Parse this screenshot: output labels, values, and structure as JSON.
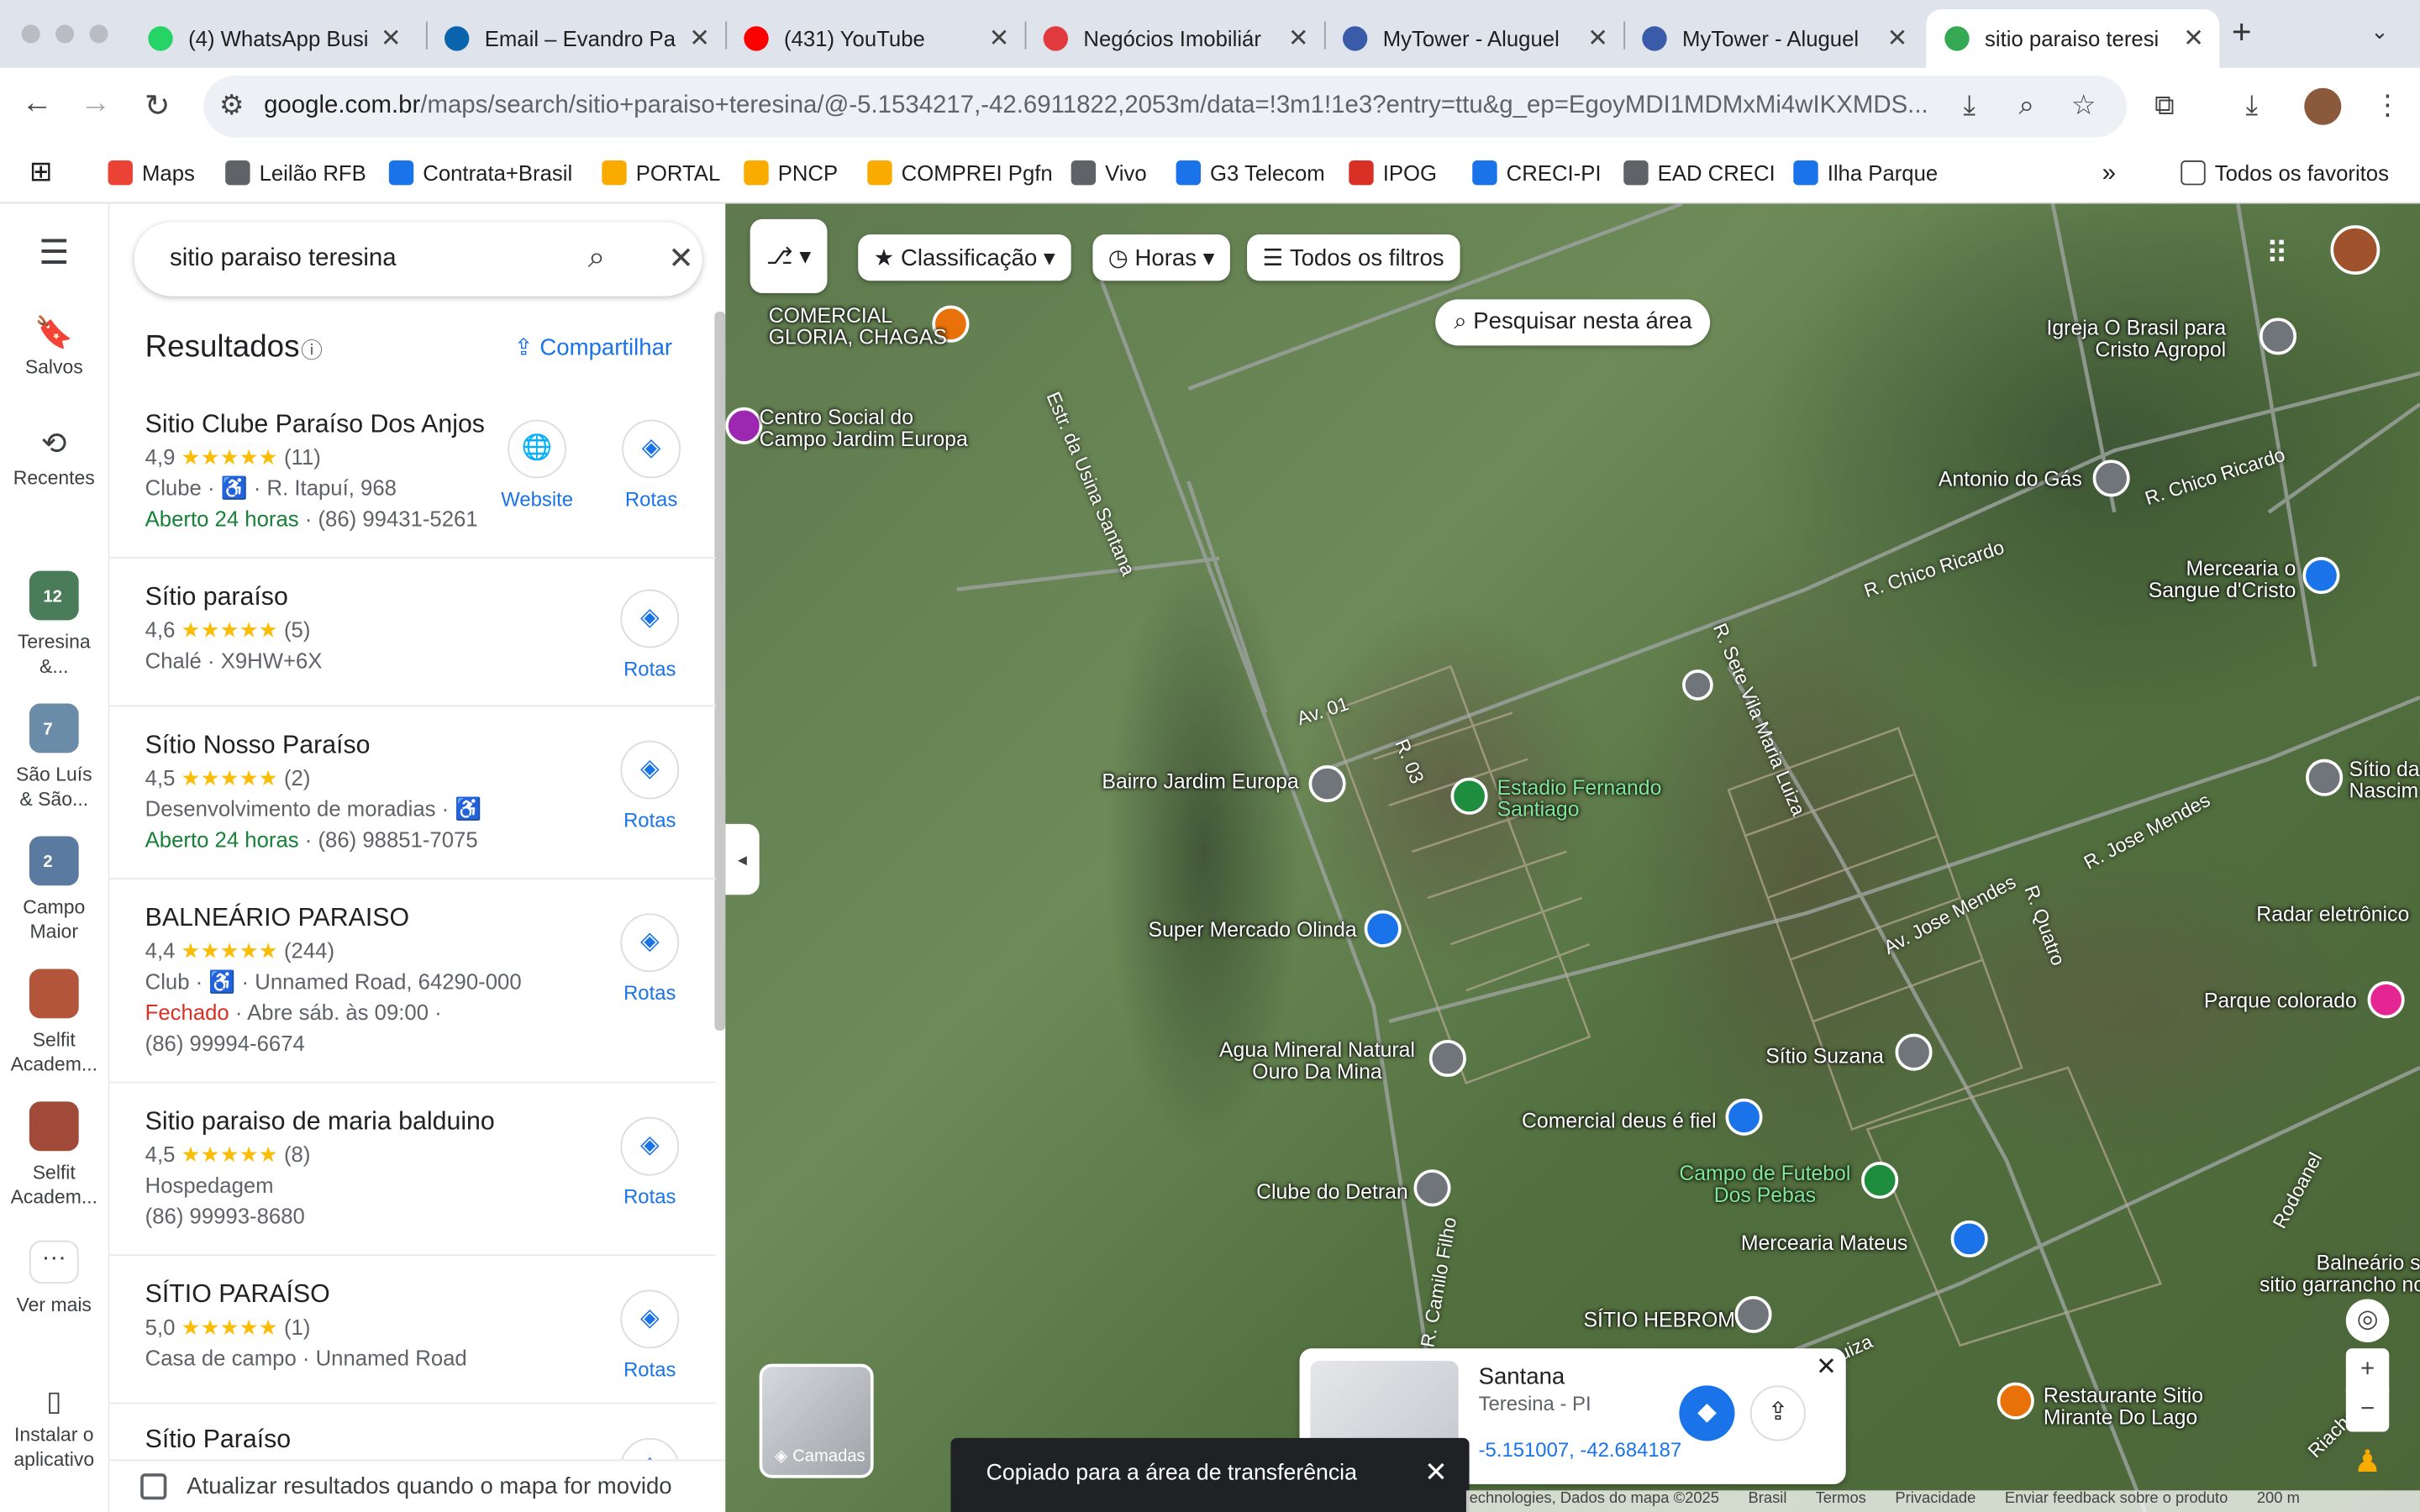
{
  "tabs": [
    {
      "label": "(4) WhatsApp Busi",
      "color": "#25d366"
    },
    {
      "label": "Email – Evandro Pa",
      "color": "#0a64ad"
    },
    {
      "label": "(431) YouTube",
      "color": "#ff0000"
    },
    {
      "label": "Negócios Imobiliár",
      "color": "#e03a3e"
    },
    {
      "label": "MyTower - Aluguel",
      "color": "#3a5ca8"
    },
    {
      "label": "MyTower - Aluguel",
      "color": "#3a5ca8"
    },
    {
      "label": "sitio paraiso teresi",
      "color": "#34a853"
    }
  ],
  "address": {
    "domain": "google.com.br",
    "path": "/maps/search/sitio+paraiso+teresina/@-5.1534217,-42.6911822,2053m/data=!3m1!1e3?entry=ttu&g_ep=EgoyMDI1MDMxMi4wIKXMDS..."
  },
  "bookmarks": [
    {
      "label": "Maps",
      "color": "#ea4335"
    },
    {
      "label": "Leilão RFB",
      "color": "#5f6368"
    },
    {
      "label": "Contrata+Brasil",
      "color": "#1a73e8"
    },
    {
      "label": "PORTAL",
      "color": "#f9ab00"
    },
    {
      "label": "PNCP",
      "color": "#f9ab00"
    },
    {
      "label": "COMPREI Pgfn",
      "color": "#f9ab00"
    },
    {
      "label": "Vivo",
      "color": "#5f6368"
    },
    {
      "label": "G3 Telecom",
      "color": "#1a73e8"
    },
    {
      "label": "IPOG",
      "color": "#d93025"
    },
    {
      "label": "CRECI-PI",
      "color": "#1a73e8"
    },
    {
      "label": "EAD CRECI",
      "color": "#5f6368"
    },
    {
      "label": "Ilha Parque",
      "color": "#1a73e8"
    }
  ],
  "bookmarks_all": "Todos os favoritos",
  "rail": {
    "saved": "Salvos",
    "recent": "Recentes",
    "lists": [
      {
        "count": "12",
        "label1": "Teresina",
        "label2": "&..."
      },
      {
        "count": "7",
        "label1": "São Luís",
        "label2": "& São..."
      },
      {
        "count": "2",
        "label1": "Campo",
        "label2": "Maior"
      },
      {
        "count": "",
        "label1": "Selfit",
        "label2": "Academ..."
      },
      {
        "count": "",
        "label1": "Selfit",
        "label2": "Academ..."
      }
    ],
    "more": "Ver mais",
    "install1": "Instalar o",
    "install2": "aplicativo"
  },
  "search": {
    "query": "sitio paraiso teresina"
  },
  "results_title": "Resultados",
  "share_label": "Compartilhar",
  "results": [
    {
      "name": "Sitio Clube Paraíso Dos Anjos",
      "rating": "4,9",
      "stars": "★★★★★",
      "count": "(11)",
      "line2": "Clube · ♿ · R. Itapuí, 968",
      "status": "Aberto 24 horas",
      "status_rest": " · (86) 99431-5261",
      "website": "Website",
      "rotas": "Rotas"
    },
    {
      "name": "Sítio paraíso",
      "rating": "4,6",
      "stars": "★★★★★",
      "count": "(5)",
      "line2": "Chalé · X9HW+6X",
      "rotas": "Rotas"
    },
    {
      "name": "Sítio Nosso Paraíso",
      "rating": "4,5",
      "stars": "★★★★★",
      "count": "(2)",
      "line2": "Desenvolvimento de moradias · ♿",
      "status": "Aberto 24 horas",
      "status_rest": " · (86) 98851-7075",
      "rotas": "Rotas"
    },
    {
      "name": "BALNEÁRIO PARAISO",
      "rating": "4,4",
      "stars": "★★★★★",
      "count": "(244)",
      "line2": "Club · ♿ · Unnamed Road, 64290-000",
      "closed": "Fechado",
      "closed_rest": " · Abre sáb. às 09:00 ·",
      "line4": "(86) 99994-6674",
      "rotas": "Rotas"
    },
    {
      "name": "Sitio paraiso de maria balduino",
      "rating": "4,5",
      "stars": "★★★★★",
      "count": "(8)",
      "line2": "Hospedagem",
      "line3": "(86) 99993-8680",
      "rotas": "Rotas"
    },
    {
      "name": "SÍTIO PARAÍSO",
      "rating": "5,0",
      "stars": "★★★★★",
      "count": "(1)",
      "line2": "Casa de campo · Unnamed Road",
      "rotas": "Rotas"
    },
    {
      "name": "Sítio Paraíso",
      "rotas": "Rotas"
    }
  ],
  "update_label": "Atualizar resultados quando o mapa for movido",
  "map": {
    "chips": [
      "Classificação",
      "Horas",
      "Todos os filtros"
    ],
    "search_area": "Pesquisar nesta área",
    "pois": [
      {
        "label": "COMERCIAL\nGLORIA, CHAGAS"
      },
      {
        "label": "Centro Social do\nCampo Jardim Europa"
      },
      {
        "label": "Igreja O Brasil para\nCristo Agropol"
      },
      {
        "label": "Antonio do Gás"
      },
      {
        "label": "Mercearia o\nSangue d'Cristo"
      },
      {
        "label": "Bairro Jardim Europa"
      },
      {
        "label": "Estadio Fernando\nSantiago"
      },
      {
        "label": "Sítio da\nNascim"
      },
      {
        "label": "Super Mercado Olinda"
      },
      {
        "label": "Radar eletrônico"
      },
      {
        "label": "Parque colorado"
      },
      {
        "label": "Agua Mineral Natural\nOuro Da Mina"
      },
      {
        "label": "Sítio Suzana"
      },
      {
        "label": "Comercial deus é fiel"
      },
      {
        "label": "Campo de Futebol\nDos Pebas"
      },
      {
        "label": "Clube do Detran"
      },
      {
        "label": "Mercearia Mateus"
      },
      {
        "label": "Balneário sitio\nsitio garrancho novo"
      },
      {
        "label": "SÍTIO HEBROM"
      },
      {
        "label": "Restaurante Sitio\nMirante Do Lago"
      }
    ],
    "roads": [
      "Estr. da Usina Santana",
      "R. Chico Ricardo",
      "R. Chico Ricardo",
      "R. Sete Vila Maria Luiza",
      "Av. 01",
      "R. 03",
      "R. Jose Mendes",
      "Av. Jose Mendes",
      "R. Quatro",
      "R. Camilo Filho",
      "Rodoanel",
      "Riacho",
      "Luiza"
    ],
    "layers": "Camadas",
    "infocard": {
      "title": "Santana",
      "subtitle": "Teresina - PI",
      "coords": "-5.151007, -42.684187"
    },
    "toast": "Copiado para a área de transferência",
    "attribution": [
      "echnologies, Dados do mapa ©2025",
      "Brasil",
      "Termos",
      "Privacidade",
      "Enviar feedback sobre o produto",
      "200 m"
    ]
  }
}
